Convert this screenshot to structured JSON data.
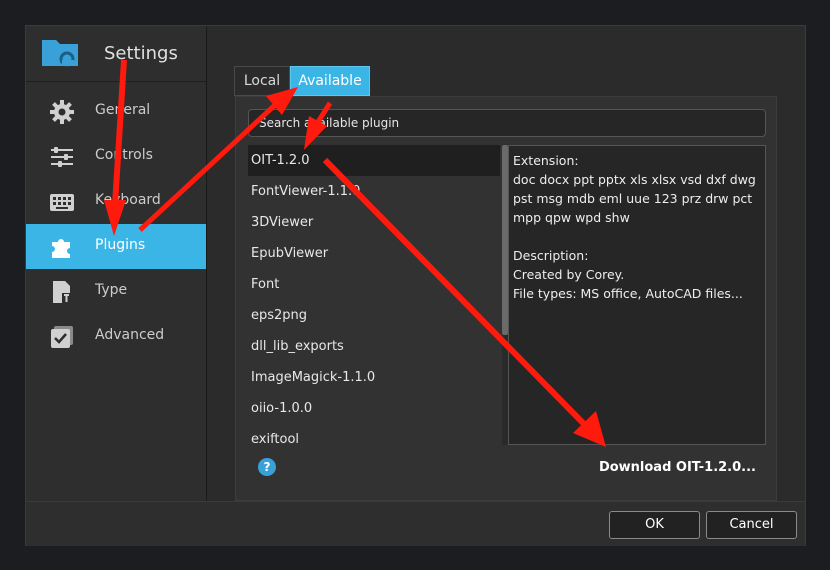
{
  "sidebar": {
    "title": "Settings",
    "items": [
      {
        "label": "General",
        "icon": "gear-icon"
      },
      {
        "label": "Controls",
        "icon": "sliders-icon"
      },
      {
        "label": "Keyboard",
        "icon": "keyboard-icon"
      },
      {
        "label": "Plugins",
        "icon": "puzzle-icon",
        "active": true
      },
      {
        "label": "Type",
        "icon": "file-type-icon"
      },
      {
        "label": "Advanced",
        "icon": "checkbox-icon"
      }
    ]
  },
  "tabs": {
    "local": "Local",
    "available": "Available",
    "active": "Available"
  },
  "search": {
    "placeholder": "Search available plugin"
  },
  "plugins": [
    "OIT-1.2.0",
    "FontViewer-1.1.0",
    "3DViewer",
    "EpubViewer",
    "Font",
    "eps2png",
    "dll_lib_exports",
    "ImageMagick-1.1.0",
    "oiio-1.0.0",
    "exiftool"
  ],
  "selected_plugin": "OIT-1.2.0",
  "details": {
    "extension_heading": "Extension:",
    "extensions": "doc docx ppt pptx xls xlsx vsd dxf dwg pst msg mdb eml uue 123 prz drw pct mpp qpw wpd shw",
    "description_heading": "Description:",
    "created_by": "Created by Corey.",
    "file_types": "File types: MS office, AutoCAD files..."
  },
  "download_label": "Download OIT-1.2.0...",
  "help_label": "?",
  "footer": {
    "ok": "OK",
    "cancel": "Cancel"
  },
  "colors": {
    "accent": "#3bb5e6",
    "annotation_arrow": "#ff1a0e"
  }
}
